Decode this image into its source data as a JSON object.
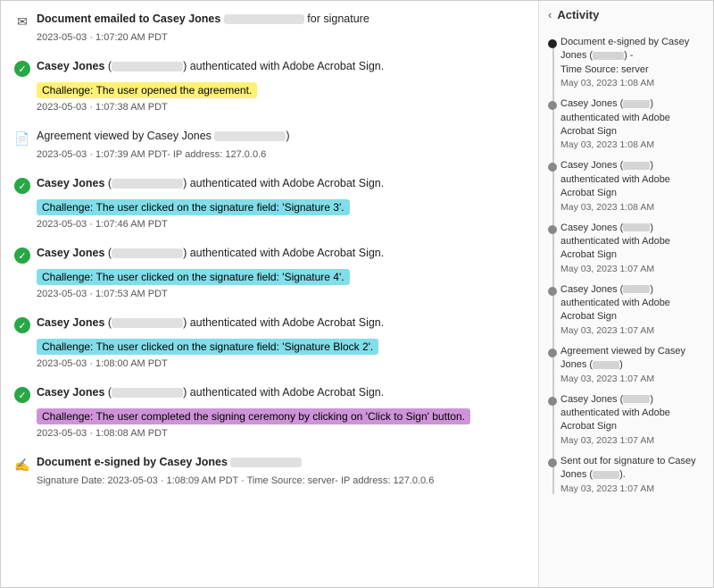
{
  "leftPanel": {
    "events": [
      {
        "id": "email-sent",
        "iconType": "email",
        "text": "Document emailed to Casey Jones",
        "textSuffix": "for signature",
        "blurredWidth": "90px",
        "challenge": null,
        "timestamp": "2023-05-03 · 1:07:20 AM PDT"
      },
      {
        "id": "auth-1",
        "iconType": "check",
        "text": "Casey Jones",
        "textMid": "authenticated with Adobe Acrobat Sign.",
        "blurredWidth": "80px",
        "challenge": {
          "text": "Challenge: The user opened the agreement.",
          "color": "yellow"
        },
        "timestamp": "2023-05-03 · 1:07:38 AM PDT"
      },
      {
        "id": "view-1",
        "iconType": "view",
        "text": "Agreement viewed by Casey Jones",
        "blurredWidth": "80px",
        "challenge": null,
        "timestamp": "2023-05-03 · 1:07:39 AM PDT- IP address: 127.0.0.6"
      },
      {
        "id": "auth-2",
        "iconType": "check",
        "text": "Casey Jones",
        "textMid": "authenticated with Adobe Acrobat Sign.",
        "blurredWidth": "80px",
        "challenge": {
          "text": "Challenge: The user clicked on the signature field: 'Signature 3'.",
          "color": "cyan"
        },
        "timestamp": "2023-05-03 · 1:07:46 AM PDT"
      },
      {
        "id": "auth-3",
        "iconType": "check",
        "text": "Casey Jones",
        "textMid": "authenticated with Adobe Acrobat Sign.",
        "blurredWidth": "80px",
        "challenge": {
          "text": "Challenge: The user clicked on the signature field: 'Signature 4'.",
          "color": "cyan"
        },
        "timestamp": "2023-05-03 · 1:07:53 AM PDT"
      },
      {
        "id": "auth-4",
        "iconType": "check",
        "text": "Casey Jones",
        "textMid": "authenticated with Adobe Acrobat Sign.",
        "blurredWidth": "80px",
        "challenge": {
          "text": "Challenge: The user clicked on the signature field: 'Signature Block 2'.",
          "color": "cyan"
        },
        "timestamp": "2023-05-03 · 1:08:00 AM PDT"
      },
      {
        "id": "auth-5",
        "iconType": "check",
        "text": "Casey Jones",
        "textMid": "authenticated with Adobe Acrobat Sign.",
        "blurredWidth": "80px",
        "challenge": {
          "text": "Challenge: The user completed the signing ceremony by clicking on 'Click to Sign' button.",
          "color": "purple"
        },
        "timestamp": "2023-05-03 · 1:08:08 AM PDT"
      },
      {
        "id": "esigned",
        "iconType": "esign",
        "text": "Document e-signed by Casey Jones",
        "blurredWidth": "80px",
        "challenge": null,
        "timestamp": "Signature Date: 2023-05-03 · 1:08:09 AM PDT · Time Source: server- IP address: 127.0.0.6"
      }
    ]
  },
  "rightPanel": {
    "title": "Activity",
    "backLabel": "‹",
    "items": [
      {
        "dotStyle": "dark",
        "text": "Document e-signed by Casey Jones (",
        "blurredWidth": "35px",
        "textSuffix": ") -",
        "extra": "Time Source: server",
        "date": "May 03, 2023 1:08 AM"
      },
      {
        "dotStyle": "normal",
        "text": "Casey Jones (",
        "blurredWidth": "30px",
        "textSuffix": ")",
        "extra": "authenticated with Adobe Acrobat Sign",
        "date": "May 03, 2023 1:08 AM"
      },
      {
        "dotStyle": "normal",
        "text": "Casey Jones (",
        "blurredWidth": "30px",
        "textSuffix": ")",
        "extra": "authenticated with Adobe Acrobat Sign",
        "date": "May 03, 2023 1:08 AM"
      },
      {
        "dotStyle": "normal",
        "text": "Casey Jones (",
        "blurredWidth": "30px",
        "textSuffix": ")",
        "extra": "authenticated with Adobe Acrobat Sign",
        "date": "May 03, 2023 1:07 AM"
      },
      {
        "dotStyle": "normal",
        "text": "Casey Jones (",
        "blurredWidth": "30px",
        "textSuffix": ")",
        "extra": "authenticated with Adobe Acrobat Sign",
        "date": "May 03, 2023 1:07 AM"
      },
      {
        "dotStyle": "normal",
        "text": "Agreement viewed by Casey Jones (",
        "blurredWidth": "30px",
        "textSuffix": ")",
        "extra": "",
        "date": "May 03, 2023 1:07 AM"
      },
      {
        "dotStyle": "normal",
        "text": "Casey Jones (",
        "blurredWidth": "30px",
        "textSuffix": ")",
        "extra": "authenticated with Adobe Acrobat Sign",
        "date": "May 03, 2023 1:07 AM"
      },
      {
        "dotStyle": "normal",
        "text": "Sent out for signature to Casey Jones (",
        "blurredWidth": "30px",
        "textSuffix": ").",
        "extra": "",
        "date": "May 03, 2023 1:07 AM"
      }
    ]
  }
}
